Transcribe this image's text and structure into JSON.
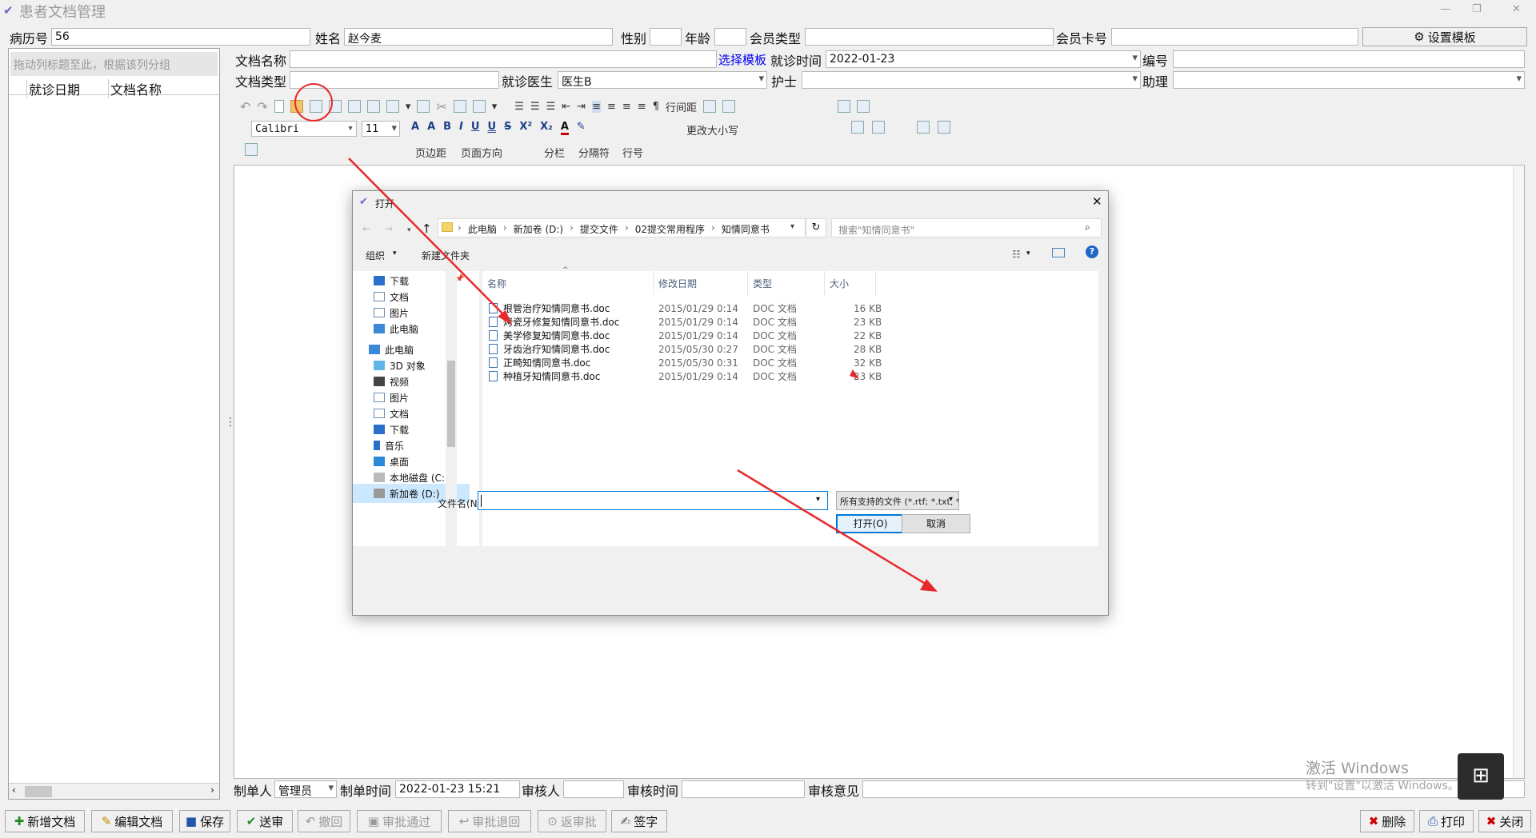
{
  "app": {
    "title": "患者文档管理",
    "win_controls": [
      "—",
      "❐",
      "✕"
    ]
  },
  "patient": {
    "record_no_label": "病历号",
    "record_no": "56",
    "name_label": "姓名",
    "name": "赵今麦",
    "gender_label": "性别",
    "gender": "",
    "age_label": "年龄",
    "age": "",
    "member_type_label": "会员类型",
    "member_type": "",
    "member_card_label": "会员卡号",
    "member_card": "",
    "set_template": "设置模板"
  },
  "doc_form": {
    "doc_name_label": "文档名称",
    "doc_name": "",
    "choose_template": "选择模板",
    "visit_time_label": "就诊时间",
    "visit_time": "2022-01-23",
    "number_label": "编号",
    "number": "",
    "doc_type_label": "文档类型",
    "doc_type": "",
    "doctor_label": "就诊医生",
    "doctor": "医生B",
    "nurse_label": "护士",
    "nurse": "",
    "assistant_label": "助理",
    "assistant": ""
  },
  "left_panel": {
    "group_hint": "拖动列标题至此，根据该列分组",
    "columns": [
      "就诊日期",
      "文档名称"
    ]
  },
  "toolbar": {
    "font": "Calibri",
    "font_size": "11",
    "change_case": "更改大小写",
    "line_spacing": "行间距",
    "margins": "页边距",
    "orientation": "页面方向",
    "columns": "分栏",
    "separator": "分隔符",
    "line_no": "行号"
  },
  "dialog": {
    "title": "打开",
    "breadcrumb": [
      "此电脑",
      "新加卷 (D:)",
      "提交文件",
      "02提交常用程序",
      "知情同意书"
    ],
    "search_placeholder": "搜索\"知情同意书\"",
    "organize": "组织",
    "new_folder": "新建文件夹",
    "nav_pinned": [
      "下载",
      "文档",
      "图片",
      "此电脑"
    ],
    "nav_tree_root": "此电脑",
    "nav_tree": [
      "3D 对象",
      "视频",
      "图片",
      "文档",
      "下载",
      "音乐",
      "桌面",
      "本地磁盘 (C:)",
      "新加卷 (D:)"
    ],
    "columns": [
      "名称",
      "修改日期",
      "类型",
      "大小"
    ],
    "files": [
      {
        "name": "根管治疗知情同意书.doc",
        "date": "2015/01/29 0:14",
        "type": "DOC 文档",
        "size": "16 KB"
      },
      {
        "name": "烤瓷牙修复知情同意书.doc",
        "date": "2015/01/29 0:14",
        "type": "DOC 文档",
        "size": "23 KB"
      },
      {
        "name": "美学修复知情同意书.doc",
        "date": "2015/01/29 0:14",
        "type": "DOC 文档",
        "size": "22 KB"
      },
      {
        "name": "牙齿治疗知情同意书.doc",
        "date": "2015/05/30 0:27",
        "type": "DOC 文档",
        "size": "28 KB"
      },
      {
        "name": "正畸知情同意书.doc",
        "date": "2015/05/30 0:31",
        "type": "DOC 文档",
        "size": "32 KB"
      },
      {
        "name": "种植牙知情同意书.doc",
        "date": "2015/01/29 0:14",
        "type": "DOC 文档",
        "size": "23 KB"
      }
    ],
    "filename_label": "文件名(N):",
    "filename_value": "",
    "filter": "所有支持的文件 (*.rtf; *.txt; *.h",
    "open_btn": "打开(O)",
    "cancel_btn": "取消"
  },
  "footer_form": {
    "creator_label": "制单人",
    "creator": "管理员",
    "create_time_label": "制单时间",
    "create_time": "2022-01-23 15:21",
    "reviewer_label": "审核人",
    "reviewer": "",
    "review_time_label": "审核时间",
    "review_time": "",
    "review_opinion_label": "审核意见",
    "review_opinion": ""
  },
  "watermark": {
    "line1": "激活 Windows",
    "line2": "转到\"设置\"以激活 Windows。"
  },
  "actions": {
    "new_doc": "新增文档",
    "edit_doc": "编辑文档",
    "save": "保存",
    "submit": "送审",
    "revoke": "撤回",
    "approve": "审批通过",
    "reject": "审批退回",
    "back_approve": "返审批",
    "sign": "签字",
    "delete": "删除",
    "print": "打印",
    "close": "关闭"
  },
  "colors": {
    "arrow": "#e8292b",
    "link": "#0000ee",
    "focus": "#0078d7"
  }
}
